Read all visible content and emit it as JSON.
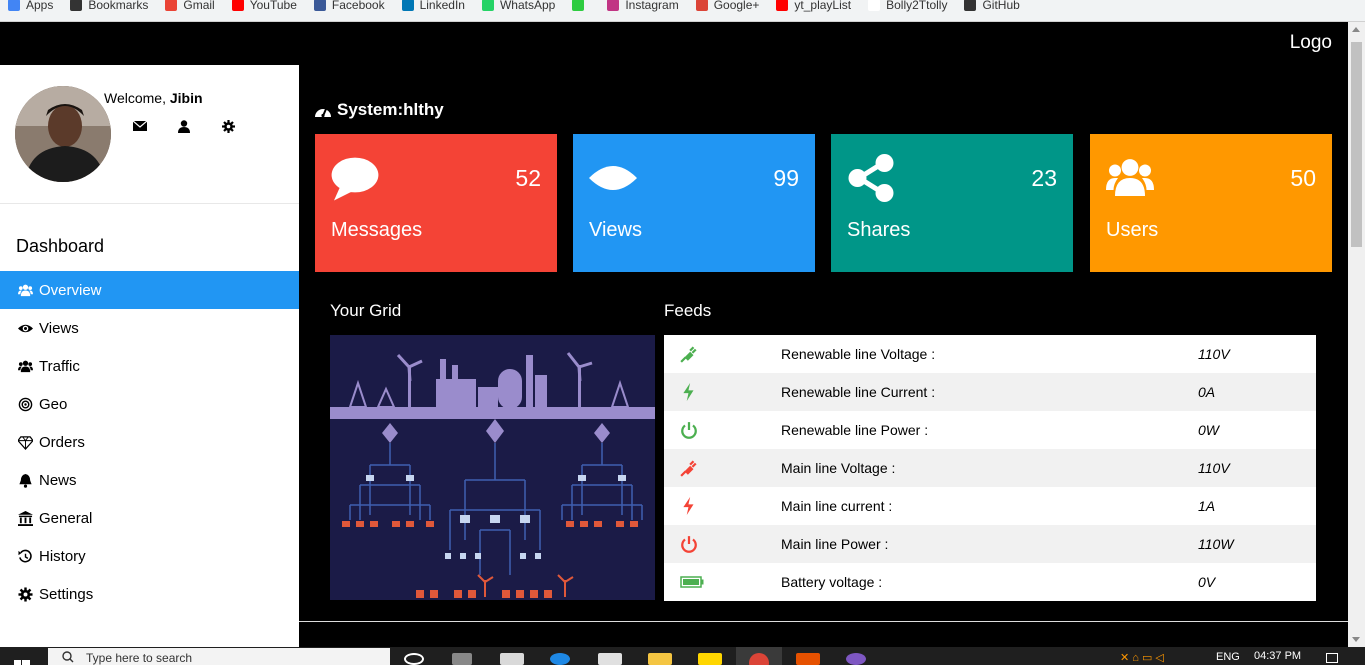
{
  "browser": {
    "bookmarks": [
      {
        "label": "Apps",
        "icon": "apps-grid-icon",
        "color": "#4285F4"
      },
      {
        "label": "Bookmarks",
        "icon": "star-icon",
        "color": "#333333"
      },
      {
        "label": "Gmail",
        "icon": "gmail-icon",
        "color": "#EA4335"
      },
      {
        "label": "YouTube",
        "icon": "youtube-icon",
        "color": "#FF0000"
      },
      {
        "label": "Facebook",
        "icon": "facebook-icon",
        "color": "#3B5998"
      },
      {
        "label": "LinkedIn",
        "icon": "linkedin-icon",
        "color": "#0077B5"
      },
      {
        "label": "WhatsApp",
        "icon": "whatsapp-icon",
        "color": "#25D366"
      },
      {
        "label": "",
        "icon": "bolt-app-icon",
        "color": "#2ECC40"
      },
      {
        "label": "Instagram",
        "icon": "instagram-icon",
        "color": "#C13584"
      },
      {
        "label": "Google+",
        "icon": "google-plus-icon",
        "color": "#DB4437"
      },
      {
        "label": "yt_playList",
        "icon": "youtube-icon",
        "color": "#FF0000"
      },
      {
        "label": "Bolly2Ttolly",
        "icon": "page-icon",
        "color": "#ffffff"
      },
      {
        "label": "GitHub",
        "icon": "github-icon",
        "color": "#333333"
      }
    ]
  },
  "header": {
    "logo": "Logo"
  },
  "sidebar": {
    "welcome_prefix": "Welcome, ",
    "user_name": "Jibin",
    "profile_buttons": [
      "envelope-icon",
      "user-icon",
      "gear-icon"
    ],
    "dashboard_title": "Dashboard",
    "items": [
      {
        "label": "Overview",
        "icon": "users-icon",
        "active": true
      },
      {
        "label": "Views",
        "icon": "eye-icon"
      },
      {
        "label": "Traffic",
        "icon": "users-icon"
      },
      {
        "label": "Geo",
        "icon": "bullseye-icon"
      },
      {
        "label": "Orders",
        "icon": "diamond-icon"
      },
      {
        "label": "News",
        "icon": "bell-icon"
      },
      {
        "label": "General",
        "icon": "bank-icon"
      },
      {
        "label": "History",
        "icon": "history-icon"
      },
      {
        "label": "Settings",
        "icon": "cog-icon"
      }
    ]
  },
  "main": {
    "system_status": "System:hlthy",
    "cards": [
      {
        "label": "Messages",
        "value": "52",
        "icon": "comment-icon",
        "color": "#F44336"
      },
      {
        "label": "Views",
        "value": "99",
        "icon": "eye-icon",
        "color": "#2196F3"
      },
      {
        "label": "Shares",
        "value": "23",
        "icon": "share-icon",
        "color": "#009688"
      },
      {
        "label": "Users",
        "value": "50",
        "icon": "users-icon",
        "color": "#FF9800"
      }
    ],
    "grid_title": "Your Grid",
    "feeds_title": "Feeds",
    "feeds": [
      {
        "label": "Renewable line Voltage :",
        "value": "110V",
        "icon": "plug-icon",
        "color": "#4CAF50"
      },
      {
        "label": "Renewable line Current :",
        "value": "0A",
        "icon": "bolt-icon",
        "color": "#4CAF50"
      },
      {
        "label": "Renewable line Power :",
        "value": "0W",
        "icon": "power-icon",
        "color": "#4CAF50"
      },
      {
        "label": "Main line Voltage :",
        "value": "110V",
        "icon": "plug-icon",
        "color": "#F44336"
      },
      {
        "label": "Main line current :",
        "value": "1A",
        "icon": "bolt-icon",
        "color": "#F44336"
      },
      {
        "label": "Main line Power :",
        "value": "110W",
        "icon": "power-icon",
        "color": "#F44336"
      },
      {
        "label": "Battery voltage :",
        "value": "0V",
        "icon": "battery-icon",
        "color": "#4CAF50"
      }
    ]
  },
  "taskbar": {
    "search_placeholder": "Type here to search",
    "language": "ENG",
    "time": "04:37 PM"
  }
}
